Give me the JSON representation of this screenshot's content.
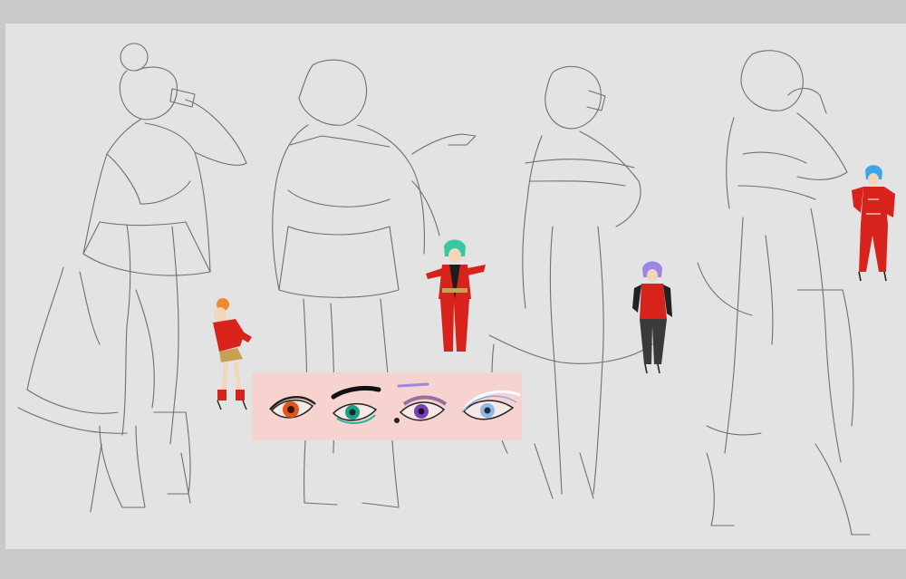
{
  "artwork": {
    "kind": "character concept sheet",
    "visible_text": "",
    "colors": {
      "frame": "#c9c9c9",
      "paper": "#e3e3e3",
      "sketch_line": "#6f6f6f",
      "costume_red": "#d8231d",
      "panel_pink": "#f6d3cf",
      "hair_orange": "#f08a2a",
      "hair_teal": "#37c9a3",
      "hair_lilac": "#9b86e6",
      "hair_blue": "#3aa6e8",
      "eye_orange": "#e0571e",
      "eye_teal": "#1f9b86",
      "eye_purple": "#7a3fb0",
      "eye_blue": "#8fb8e8"
    },
    "sketch_figures": [
      "figure-back-bun",
      "figure-back-bob",
      "figure-back-short-hair",
      "figure-back-right"
    ],
    "color_figures": [
      {
        "name": "orange-hair-girl",
        "hair": "hair_orange"
      },
      {
        "name": "teal-hair-girl",
        "hair": "hair_teal"
      },
      {
        "name": "lilac-hair-girl",
        "hair": "hair_lilac"
      },
      {
        "name": "blue-hair-girl",
        "hair": "hair_blue"
      }
    ],
    "eye_swatches": [
      "eye-orange",
      "eye-teal",
      "eye-purple",
      "eye-blue"
    ]
  }
}
